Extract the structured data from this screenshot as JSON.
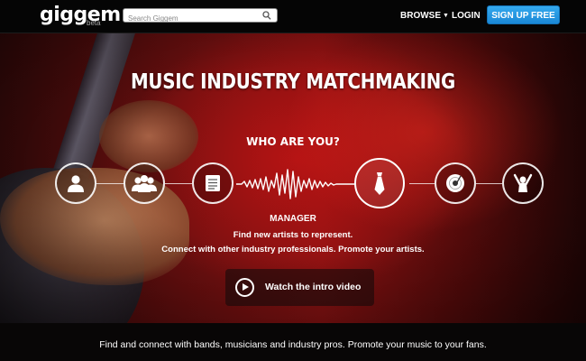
{
  "header": {
    "logo": "giggem",
    "logo_badge": "beta",
    "search_placeholder": "Search Giggem",
    "nav_browse": "BROWSE",
    "nav_login": "LOGIN",
    "signup_label": "SIGN UP FREE",
    "signup_color": "#2b9de6"
  },
  "hero": {
    "headline": "MUSIC INDUSTRY MATCHMAKING",
    "who_prompt": "WHO ARE YOU?",
    "roles": [
      {
        "icon": "person-icon"
      },
      {
        "icon": "group-icon"
      },
      {
        "icon": "document-icon"
      },
      {
        "icon": "tie-icon",
        "active": true
      },
      {
        "icon": "disc-icon"
      },
      {
        "icon": "fan-icon"
      }
    ],
    "selected_role": {
      "name": "MANAGER",
      "line1": "Find new artists to represent.",
      "line2": "Connect with other industry professionals. Promote your artists."
    },
    "video_label": "Watch the intro video"
  },
  "footer": {
    "tagline": "Find and connect with bands, musicians and industry pros. Promote your music to your fans."
  }
}
